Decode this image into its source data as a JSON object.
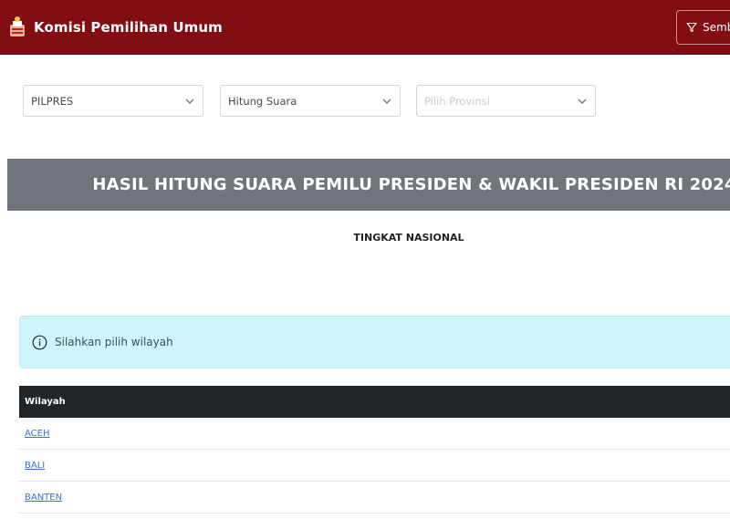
{
  "header": {
    "brand_name": "Komisi Pemilihan Umum",
    "toggle_label": "Semb",
    "brand_color": "#820e13"
  },
  "filters": {
    "pemilu": "PILPRES",
    "jenis": "Hitung Suara",
    "provinsi_placeholder": "Pilih Provinsi"
  },
  "main": {
    "title": "HASIL HITUNG SUARA PEMILU PRESIDEN & WAKIL PRESIDEN RI 2024",
    "level": "TINGKAT NASIONAL",
    "alert": "Silahkan pilih wilayah"
  },
  "table": {
    "header": "Wilayah",
    "rows": [
      "ACEH",
      "BALI",
      "BANTEN"
    ]
  }
}
